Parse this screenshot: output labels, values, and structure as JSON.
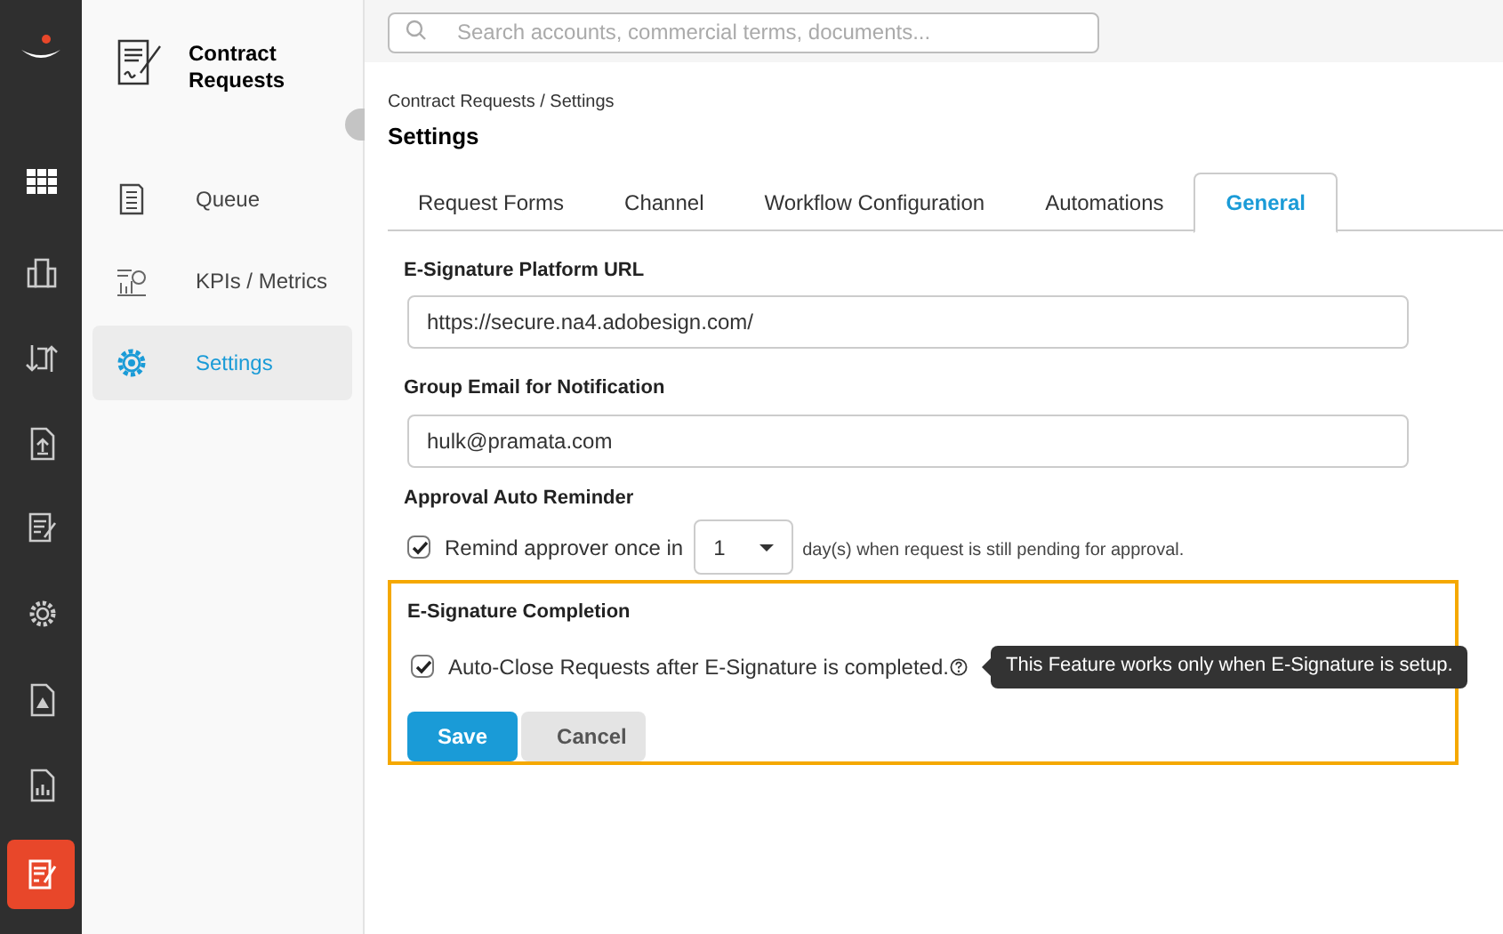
{
  "rail": [
    {
      "kind": "grid",
      "selected": false
    },
    {
      "kind": "building",
      "selected": false
    },
    {
      "kind": "transfer",
      "selected": false
    },
    {
      "kind": "upload",
      "selected": false
    },
    {
      "kind": "edit",
      "selected": false
    },
    {
      "kind": "gear",
      "selected": false
    },
    {
      "kind": "alert",
      "selected": false
    },
    {
      "kind": "report",
      "selected": false
    },
    {
      "kind": "contract",
      "selected": true
    }
  ],
  "sidebar": {
    "title": "Contract Requests",
    "items": [
      {
        "kind": "queue",
        "label": "Queue",
        "selected": false
      },
      {
        "kind": "metrics",
        "label": "KPIs / Metrics",
        "selected": false
      },
      {
        "kind": "settings",
        "label": "Settings",
        "selected": true
      }
    ]
  },
  "search": {
    "placeholder": "Search accounts, commercial terms, documents..."
  },
  "breadcrumb": "Contract Requests / Settings",
  "page_title": "Settings",
  "tabs": [
    {
      "label": "Request Forms",
      "selected": false
    },
    {
      "label": "Channel",
      "selected": false
    },
    {
      "label": "Workflow Configuration",
      "selected": false
    },
    {
      "label": "Automations",
      "selected": false
    },
    {
      "label": "General",
      "selected": true
    }
  ],
  "fields": [
    {
      "label": "E-Signature Platform URL",
      "value": "https://secure.na4.adobesign.com/"
    },
    {
      "label": "Group Email for Notification",
      "value": "hulk@pramata.com"
    }
  ],
  "reminder": {
    "label": "Approval Auto Reminder",
    "checked": true,
    "text": "Remind approver once in",
    "days": "1",
    "suffix": "day(s) when request is still pending for approval."
  },
  "esignature": {
    "label": "E-Signature Completion",
    "checked": true,
    "text": "Auto-Close Requests after E-Signature is completed.",
    "tooltip": "This Feature works only when E-Signature is setup."
  },
  "buttons": [
    {
      "kind": "primary",
      "label": "Save"
    },
    {
      "kind": "secondary",
      "label": "Cancel"
    }
  ]
}
